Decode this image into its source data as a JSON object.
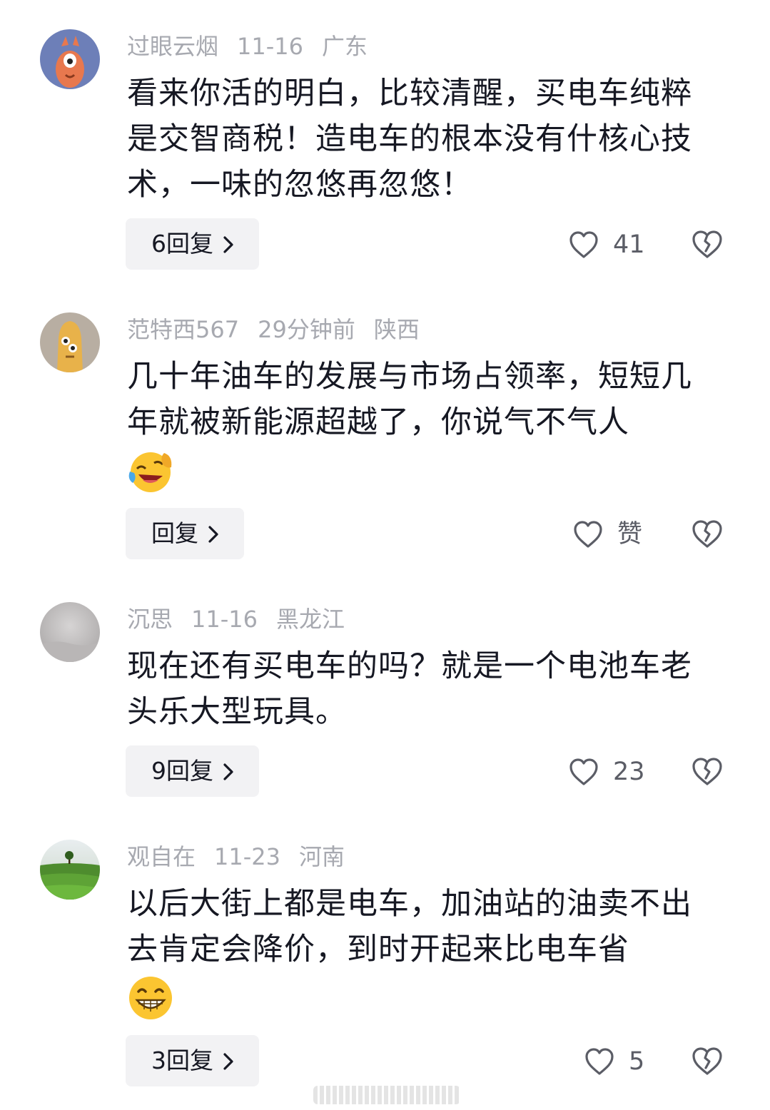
{
  "comments": [
    {
      "username": "过眼云烟",
      "time": "11-16",
      "location": "广东",
      "text": "看来你活的明白，比较清醒，买电车纯粹是交智商税！造电车的根本没有什核心技术，一味的忽悠再忽悠！",
      "replies_label": "6回复",
      "likes": "41"
    },
    {
      "username": "范特西567",
      "time": "29分钟前",
      "location": "陕西",
      "text": "几十年油车的发展与市场占领率，短短几年就被新能源超越了，你说气不气人",
      "emoji": "laughing-crying-emoji",
      "replies_label": "回复",
      "likes": "赞"
    },
    {
      "username": "沉思",
      "time": "11-16",
      "location": "黑龙江",
      "text": "现在还有买电车的吗？就是一个电池车老头乐大型玩具。",
      "replies_label": "9回复",
      "likes": "23"
    },
    {
      "username": "观自在",
      "time": "11-23",
      "location": "河南",
      "text": "以后大街上都是电车，加油站的油卖不出去肯定会降价，到时开起来比电车省",
      "emoji": "grinning-emoji",
      "replies_label": "3回复",
      "likes": "5"
    }
  ],
  "icons": {
    "like": "heart-outline-icon",
    "dislike": "broken-heart-icon",
    "chevron": "chevron-right-icon"
  },
  "colors": {
    "meta_text": "#a7a9b0",
    "body_text": "#161823",
    "reply_bg": "#f2f2f4",
    "icon": "#5b5d66"
  }
}
